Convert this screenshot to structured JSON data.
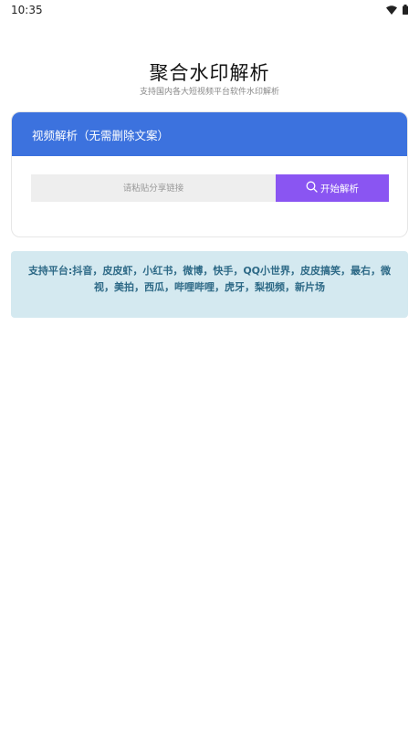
{
  "status_bar": {
    "time": "10:35",
    "icons": [
      "wifi-icon",
      "battery-icon"
    ]
  },
  "header": {
    "title": "聚合水印解析",
    "subtitle": "支持国内各大短视频平台软件水印解析"
  },
  "parse_card": {
    "title": "视频解析（无需删除文案）",
    "input": {
      "placeholder": "请粘贴分享链接",
      "value": ""
    },
    "button_label": "开始解析",
    "button_icon": "search-icon"
  },
  "platforms_notice": {
    "text": "支持平台:抖音，皮皮虾，小红书，微博，快手，QQ小世界，皮皮搞笑，最右，微视，美拍，西瓜，哔哩哔哩，虎牙，梨视频，新片场"
  },
  "colors": {
    "header_blue": "#3c72de",
    "button_purple": "#8a55f2",
    "notice_bg": "#d4e9f0",
    "notice_text": "#2e6a87"
  }
}
